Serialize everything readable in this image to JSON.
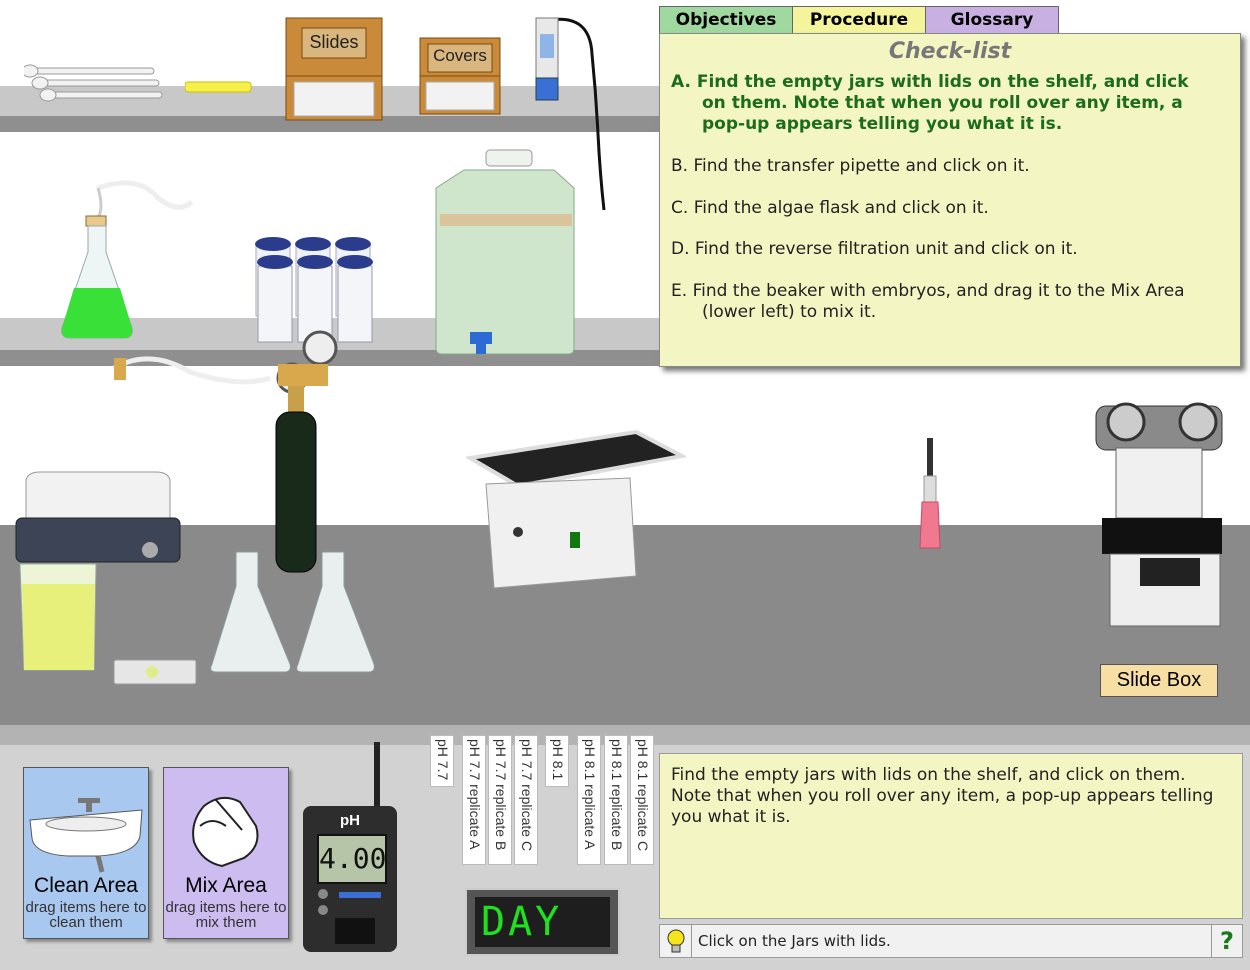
{
  "tabs": [
    {
      "label": "Objectives",
      "color": "#9fd99f"
    },
    {
      "label": "Procedure",
      "color": "#f4f49c"
    },
    {
      "label": "Glossary",
      "color": "#c9b0e3"
    }
  ],
  "checklist": {
    "title": "Check-list",
    "items": [
      {
        "letter": "A.",
        "text": "Find the empty jars with lids on the shelf, and click",
        "rest": "on them. Note that when you roll over any item, a pop-up appears telling you what it is.",
        "active": true
      },
      {
        "letter": "B.",
        "text": "Find the transfer pipette and click on it.",
        "rest": ""
      },
      {
        "letter": "C.",
        "text": "Find the algae flask and click on it.",
        "rest": ""
      },
      {
        "letter": "D.",
        "text": "Find the reverse filtration unit and click on it.",
        "rest": ""
      },
      {
        "letter": "E.",
        "text": "Find the beaker with embryos, and drag it to the Mix Area",
        "rest": "(lower left) to mix it."
      }
    ]
  },
  "shelf_labels": {
    "slides": "Slides",
    "covers": "Covers"
  },
  "slide_box": "Slide Box",
  "clean_area": {
    "title": "Clean Area",
    "sub": "drag items here to clean them"
  },
  "mix_area": {
    "title": "Mix Area",
    "sub": "drag items here to mix them"
  },
  "ph_meter": {
    "title": "pH",
    "reading": "4.00"
  },
  "ph_labels": [
    "pH 7.7",
    "pH 7.7 replicate A",
    "pH 7.7 replicate B",
    "pH 7.7 replicate C",
    "pH 8.1",
    "pH 8.1 replicate A",
    "pH 8.1 replicate B",
    "pH 8.1 replicate C"
  ],
  "day_display": "DAY",
  "info_text": "Find the empty jars with lids on the shelf, and click on them. Note that when you roll over any item, a pop-up appears telling you what it is.",
  "hint_text": "Click on the Jars with lids.",
  "help_label": "?"
}
